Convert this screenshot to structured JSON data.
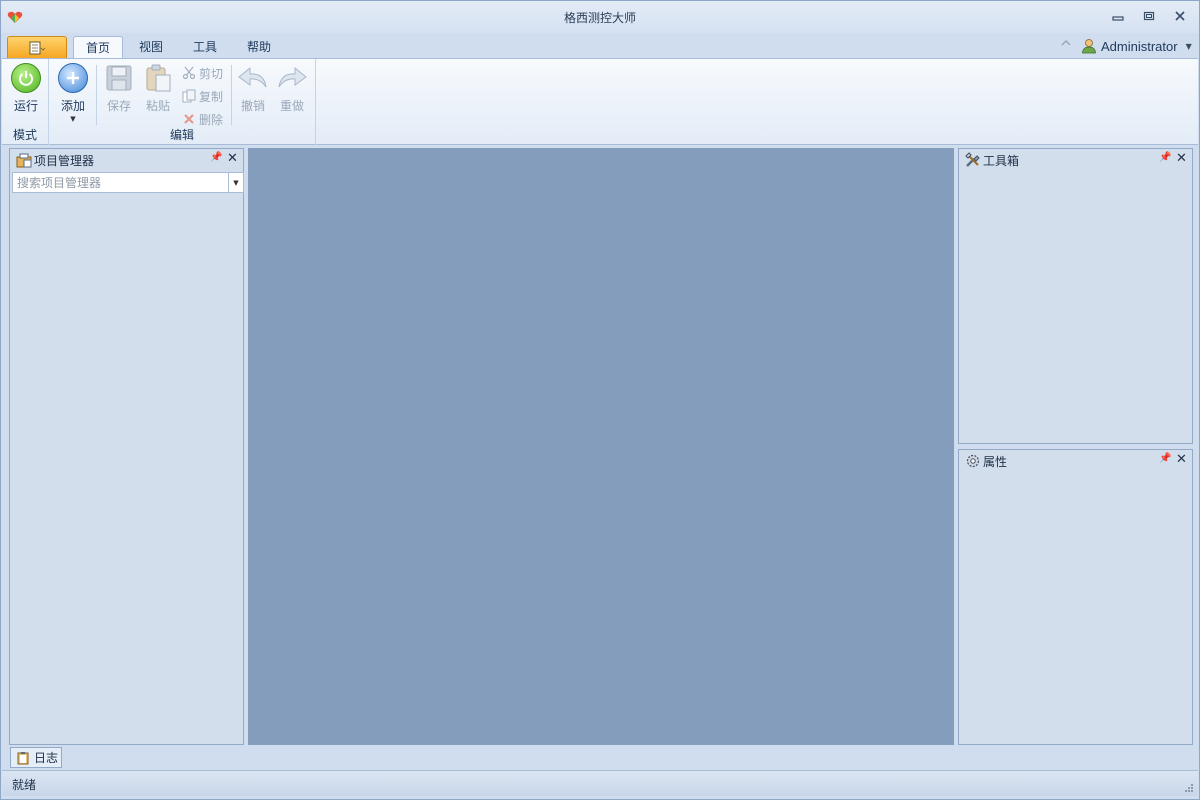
{
  "window": {
    "title": "格西测控大师",
    "minimize_icon": "minimize-icon",
    "maximize_icon": "restore-icon",
    "close_icon": "close-icon"
  },
  "ribbon": {
    "tabs": [
      {
        "label": "首页",
        "active": true
      },
      {
        "label": "视图",
        "active": false
      },
      {
        "label": "工具",
        "active": false
      },
      {
        "label": "帮助",
        "active": false
      }
    ],
    "user": "Administrator",
    "groups": {
      "mode": {
        "label": "模式",
        "run_label": "运行"
      },
      "edit": {
        "label": "编辑",
        "add_label": "添加",
        "save_label": "保存",
        "paste_label": "粘贴",
        "cut_label": "剪切",
        "copy_label": "复制",
        "delete_label": "删除",
        "undo_label": "撤销",
        "redo_label": "重做"
      }
    }
  },
  "panels": {
    "project_manager": {
      "title": "项目管理器",
      "search_placeholder": "搜索项目管理器"
    },
    "toolbox": {
      "title": "工具箱"
    },
    "properties": {
      "title": "属性"
    }
  },
  "bottom_tabs": {
    "log_label": "日志"
  },
  "status": {
    "text": "就绪"
  },
  "colors": {
    "doc_area": "#849dbd",
    "panel_bg": "#d3deed",
    "app_menu": "#f6a623"
  }
}
